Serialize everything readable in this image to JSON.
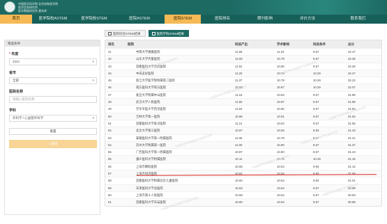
{
  "header": {
    "logo_line1": "中国医学科学院 北京协和医学院",
    "logo_line2": "医学信息研究所",
    "logo_line3": "医学数据研究所 基本库"
  },
  "nav": {
    "items": [
      "首页",
      "医学院校ASTEM",
      "医学院校STEM",
      "医院ASTEM",
      "医院STEM",
      "医院排名",
      "期刊影响",
      "评价方法",
      "联系我们"
    ],
    "active_index": 4
  },
  "filter": {
    "heading": "筛选条件",
    "year_label": "年度",
    "year_value": "2022",
    "province_label": "省市",
    "province_value": "全部",
    "hospital_label": "医院名称",
    "hospital_placeholder": "请输入医院名称",
    "subject_label": "学科",
    "subject_value": "外科学 / 心血管外科学",
    "reset_label": "重置",
    "query_label": "查询",
    "required_mark": "*"
  },
  "tabs": [
    {
      "label": "医院综合STEM结果",
      "active": false
    },
    {
      "label": "医院学科STEM结果",
      "active": true
    }
  ],
  "table": {
    "columns": [
      "排名",
      "医院",
      "科技产出",
      "学术影响",
      "科技条件",
      "总分"
    ],
    "rows": [
      [
        "41",
        "中南大学湘雅医院",
        "11.66",
        "11.24",
        "9.57",
        "32.47"
      ],
      [
        "42",
        "山东大学齐鲁医院",
        "12.00",
        "10.78",
        "9.57",
        "32.35"
      ],
      [
        "43",
        "首都医科大学宣武医院",
        "11.52",
        "10.80",
        "9.57",
        "32.30"
      ],
      [
        "44",
        "中日友好医院",
        "11.20",
        "10.79",
        "10.29",
        "32.27"
      ],
      [
        "45",
        "浙江大学医学院附属第二医院",
        "11.37",
        "10.78",
        "10.29",
        "32.22"
      ],
      [
        "46",
        "南方医科大学南方医院",
        "10.88",
        "10.87",
        "10.29",
        "32.07"
      ],
      [
        "47",
        "复旦大学附属中山医院",
        "11.15",
        "10.84",
        "9.57",
        "31.96"
      ],
      [
        "48",
        "武汉大学人民医院",
        "11.50",
        "10.87",
        "9.57",
        "31.89"
      ],
      [
        "49",
        "空军军医大学西京医院",
        "11.53",
        "10.80",
        "9.57",
        "31.84"
      ],
      [
        "50",
        "吉林大学第一医院",
        "10.86",
        "10.91",
        "9.57",
        "31.62"
      ],
      [
        "51",
        "首都医科大学安贞医院",
        "11.21",
        "10.54",
        "9.57",
        "31.55"
      ],
      [
        "52",
        "北京大学第三医院",
        "10.67",
        "10.83",
        "9.93",
        "31.43"
      ],
      [
        "53",
        "安徽医科大学第一附属医院",
        "11.06",
        "10.78",
        "9.57",
        "31.41"
      ],
      [
        "54",
        "苏州大学附属第一医院",
        "11.00",
        "10.80",
        "9.57",
        "31.37"
      ],
      [
        "55",
        "广西医科大学第一附属医院",
        "10.87",
        "10.80",
        "9.57",
        "31.24"
      ],
      [
        "55",
        "遵义医科大学附属医院",
        "10.11",
        "10.75",
        "10.29",
        "31.16"
      ],
      [
        "56",
        "上海市胸科医院",
        "10.65",
        "10.54",
        "9.93",
        "31.12"
      ],
      [
        "57",
        "上海市同济医院",
        "10.81",
        "10.54",
        "9.93",
        "31.06"
      ],
      [
        "58",
        "首都医科大学附属北京儿童医院",
        "10.60",
        "10.64",
        "9.93",
        "31.01"
      ],
      [
        "59",
        "天津医科大学总医院",
        "10.63",
        "10.54",
        "9.57",
        "30.98"
      ],
      [
        "60",
        "上海市第十人民医院",
        "10.58",
        "10.64",
        "9.57",
        "30.93"
      ],
      [
        "61",
        "首都医科大学天坛医院",
        "10.60",
        "10.54",
        "9.57",
        "30.89"
      ]
    ]
  },
  "watermark": "中国医学科学院医学信息研究所"
}
